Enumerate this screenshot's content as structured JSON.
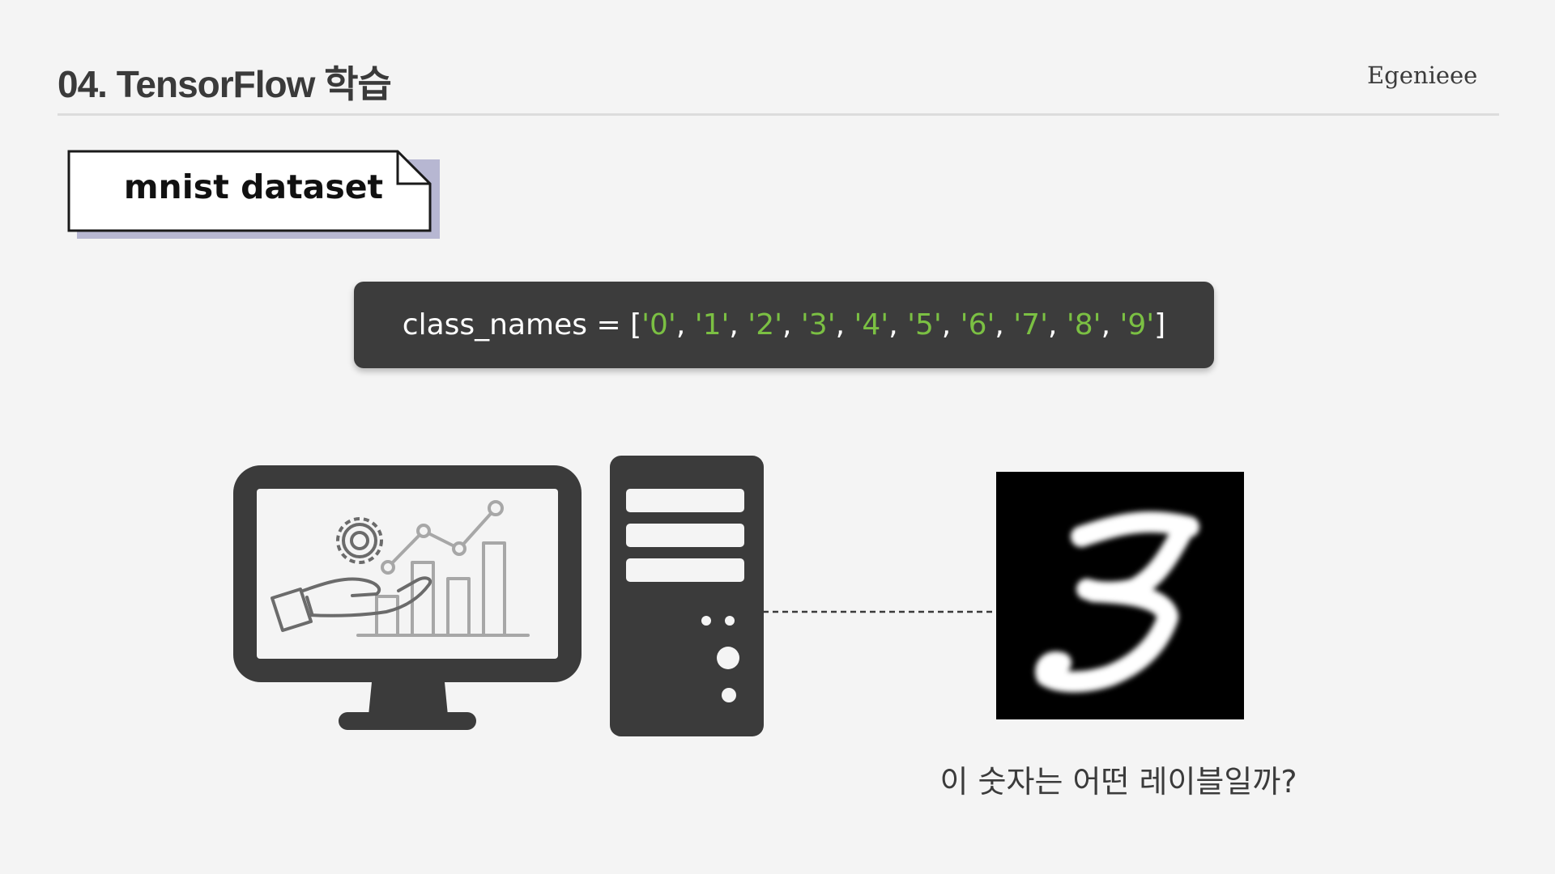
{
  "header": {
    "title": "04. TensorFlow 학습",
    "brand": "Egenieee"
  },
  "section_tag": {
    "label": "mnist dataset"
  },
  "code": {
    "prefix": "class_names = [",
    "items": [
      "'0'",
      "'1'",
      "'2'",
      "'3'",
      "'4'",
      "'5'",
      "'6'",
      "'7'",
      "'8'",
      "'9'"
    ],
    "separator": ", ",
    "suffix": "]"
  },
  "digit_image": {
    "digit": "3"
  },
  "question": "이 숫자는 어떤 레이블일까?",
  "icons": {
    "monitor": "monitor-icon",
    "computer_tower": "computer-tower-icon",
    "analytics": "hand-gear-growth-chart-icon"
  },
  "colors": {
    "background": "#f4f4f4",
    "code_background": "#3c3c3c",
    "code_string": "#7bc043",
    "device_dark": "#3b3b3b",
    "tag_shadow": "#b7b7d2"
  }
}
